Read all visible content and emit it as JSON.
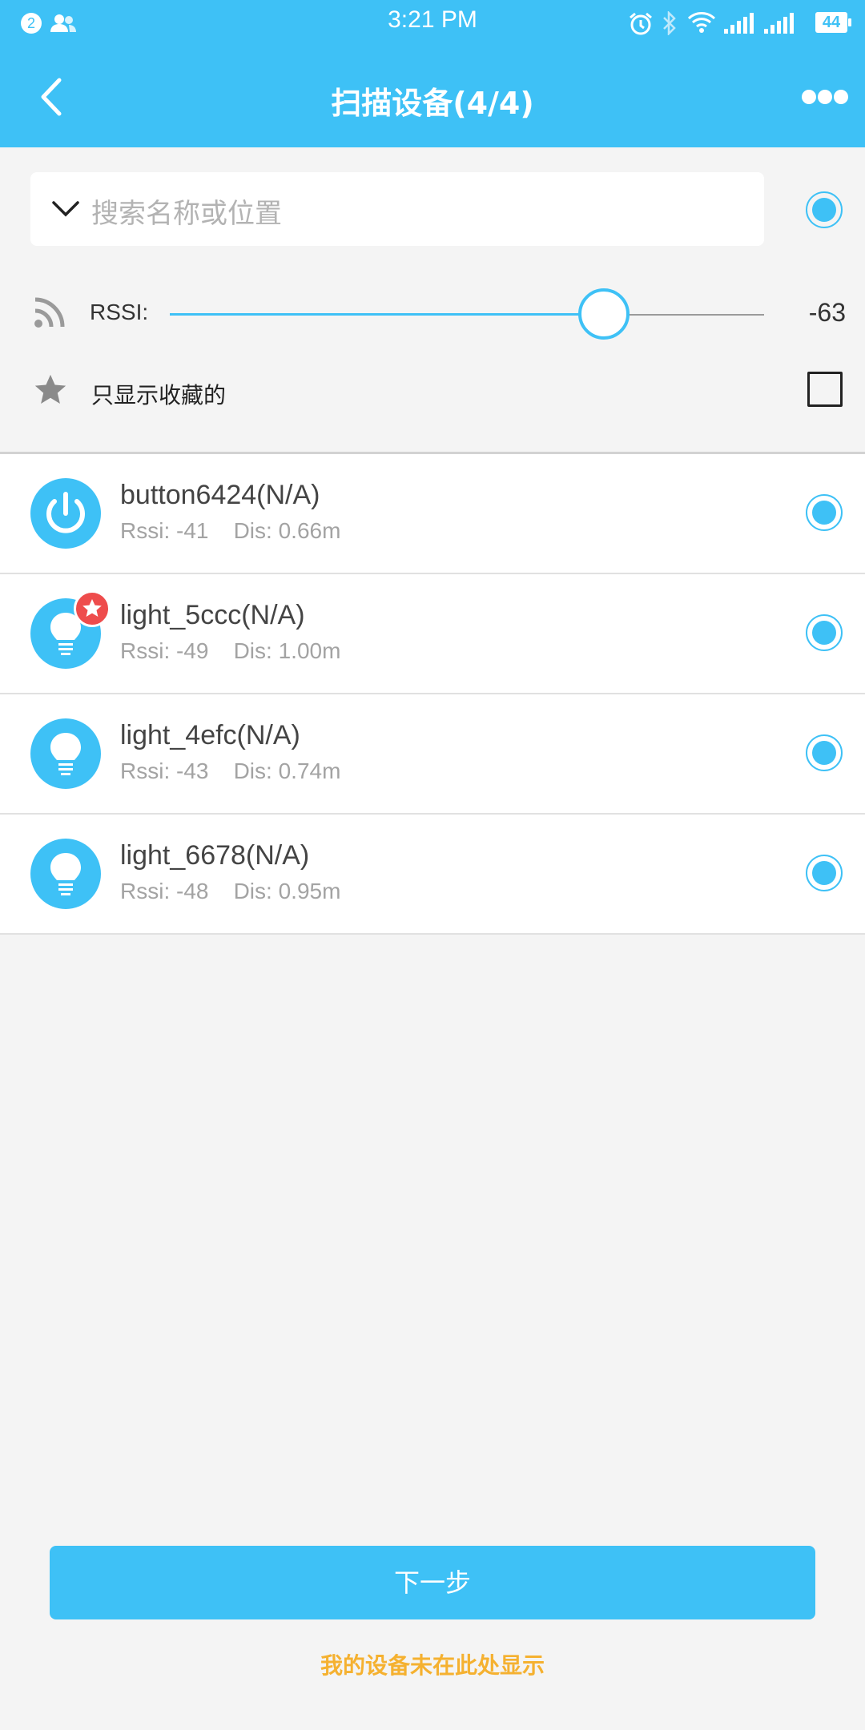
{
  "status_bar": {
    "notification_count": "2",
    "time": "3:21 PM",
    "battery": "44",
    "icons": [
      "contacts-icon",
      "alarm-icon",
      "bluetooth-icon",
      "wifi-icon",
      "signal-icon",
      "signal-2-icon",
      "battery-icon"
    ]
  },
  "app_bar": {
    "title": "扫描设备(4/4)",
    "back_icon": "back-arrow-icon",
    "more_icon": "more-icon"
  },
  "search": {
    "placeholder": "搜索名称或位置"
  },
  "filter": {
    "rssi_label": "RSSI:",
    "rssi_value": "-63",
    "rssi_slider_fraction": 0.73,
    "favorites_label": "只显示收藏的",
    "favorites_checked": false
  },
  "devices": [
    {
      "name": "button6424(N/A)",
      "meta": "Rssi: -41    Dis: 0.66m",
      "icon": "power-icon",
      "favorite": false
    },
    {
      "name": "light_5ccc(N/A)",
      "meta": "Rssi: -49    Dis: 1.00m",
      "icon": "bulb-icon",
      "favorite": true
    },
    {
      "name": "light_4efc(N/A)",
      "meta": "Rssi: -43    Dis: 0.74m",
      "icon": "bulb-icon",
      "favorite": false
    },
    {
      "name": "light_6678(N/A)",
      "meta": "Rssi: -48    Dis: 0.95m",
      "icon": "bulb-icon",
      "favorite": false
    }
  ],
  "footer": {
    "next_label": "下一步",
    "missing_label": "我的设备未在此处显示"
  },
  "colors": {
    "accent": "#3ec1f6",
    "favorite_badge": "#ee4c4c",
    "link": "#f5b130"
  }
}
